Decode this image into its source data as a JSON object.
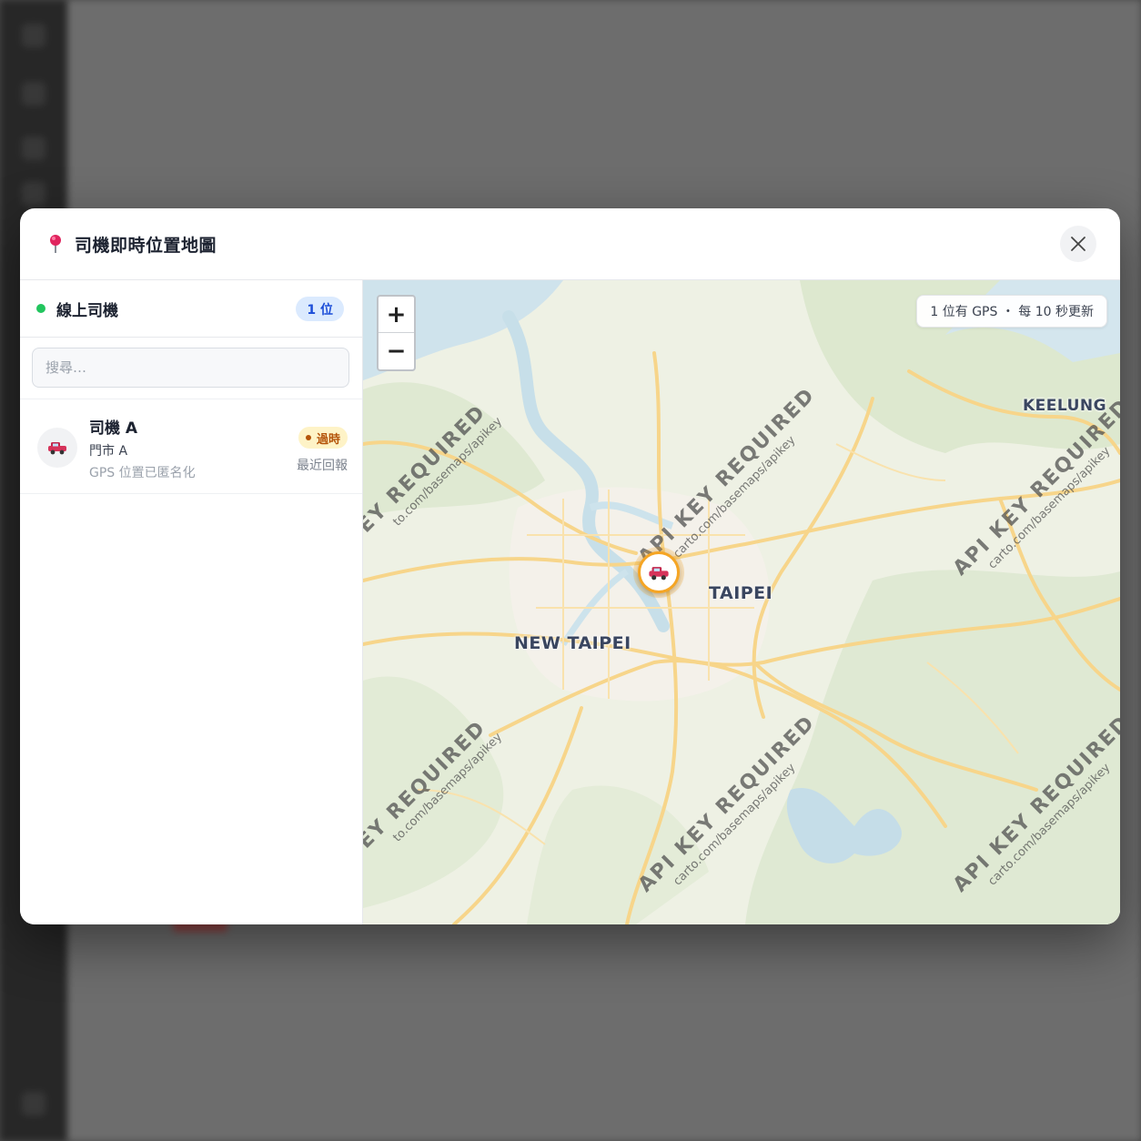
{
  "modal": {
    "title": "司機即時位置地圖"
  },
  "sidebar": {
    "title": "線上司機",
    "count": "1 位",
    "search_placeholder": "搜尋…"
  },
  "drivers": [
    {
      "name": "司機 A",
      "store": "門市 A",
      "gps_note": "GPS 位置已匿名化",
      "status": "過時",
      "recent": "最近回報"
    }
  ],
  "map": {
    "zoom_in": "+",
    "zoom_out": "−",
    "gps_info": "1 位有 GPS ・ 每 10 秒更新",
    "cities": {
      "keelung": "KEELUNG",
      "taipei": "TAIPEI",
      "new_taipei": "NEW TAIPEI"
    },
    "watermark_main": "API KEY REQUIRED",
    "watermark_sub": "carto.com/basemaps/apikey",
    "watermark_main_cut": "EY REQUIRED",
    "watermark_sub_cut": "to.com/basemaps/apikey"
  },
  "colors": {
    "accent": "#1d4ed8",
    "online": "#22c55e",
    "stale": "#b45309",
    "marker_ring": "#f5a524"
  }
}
